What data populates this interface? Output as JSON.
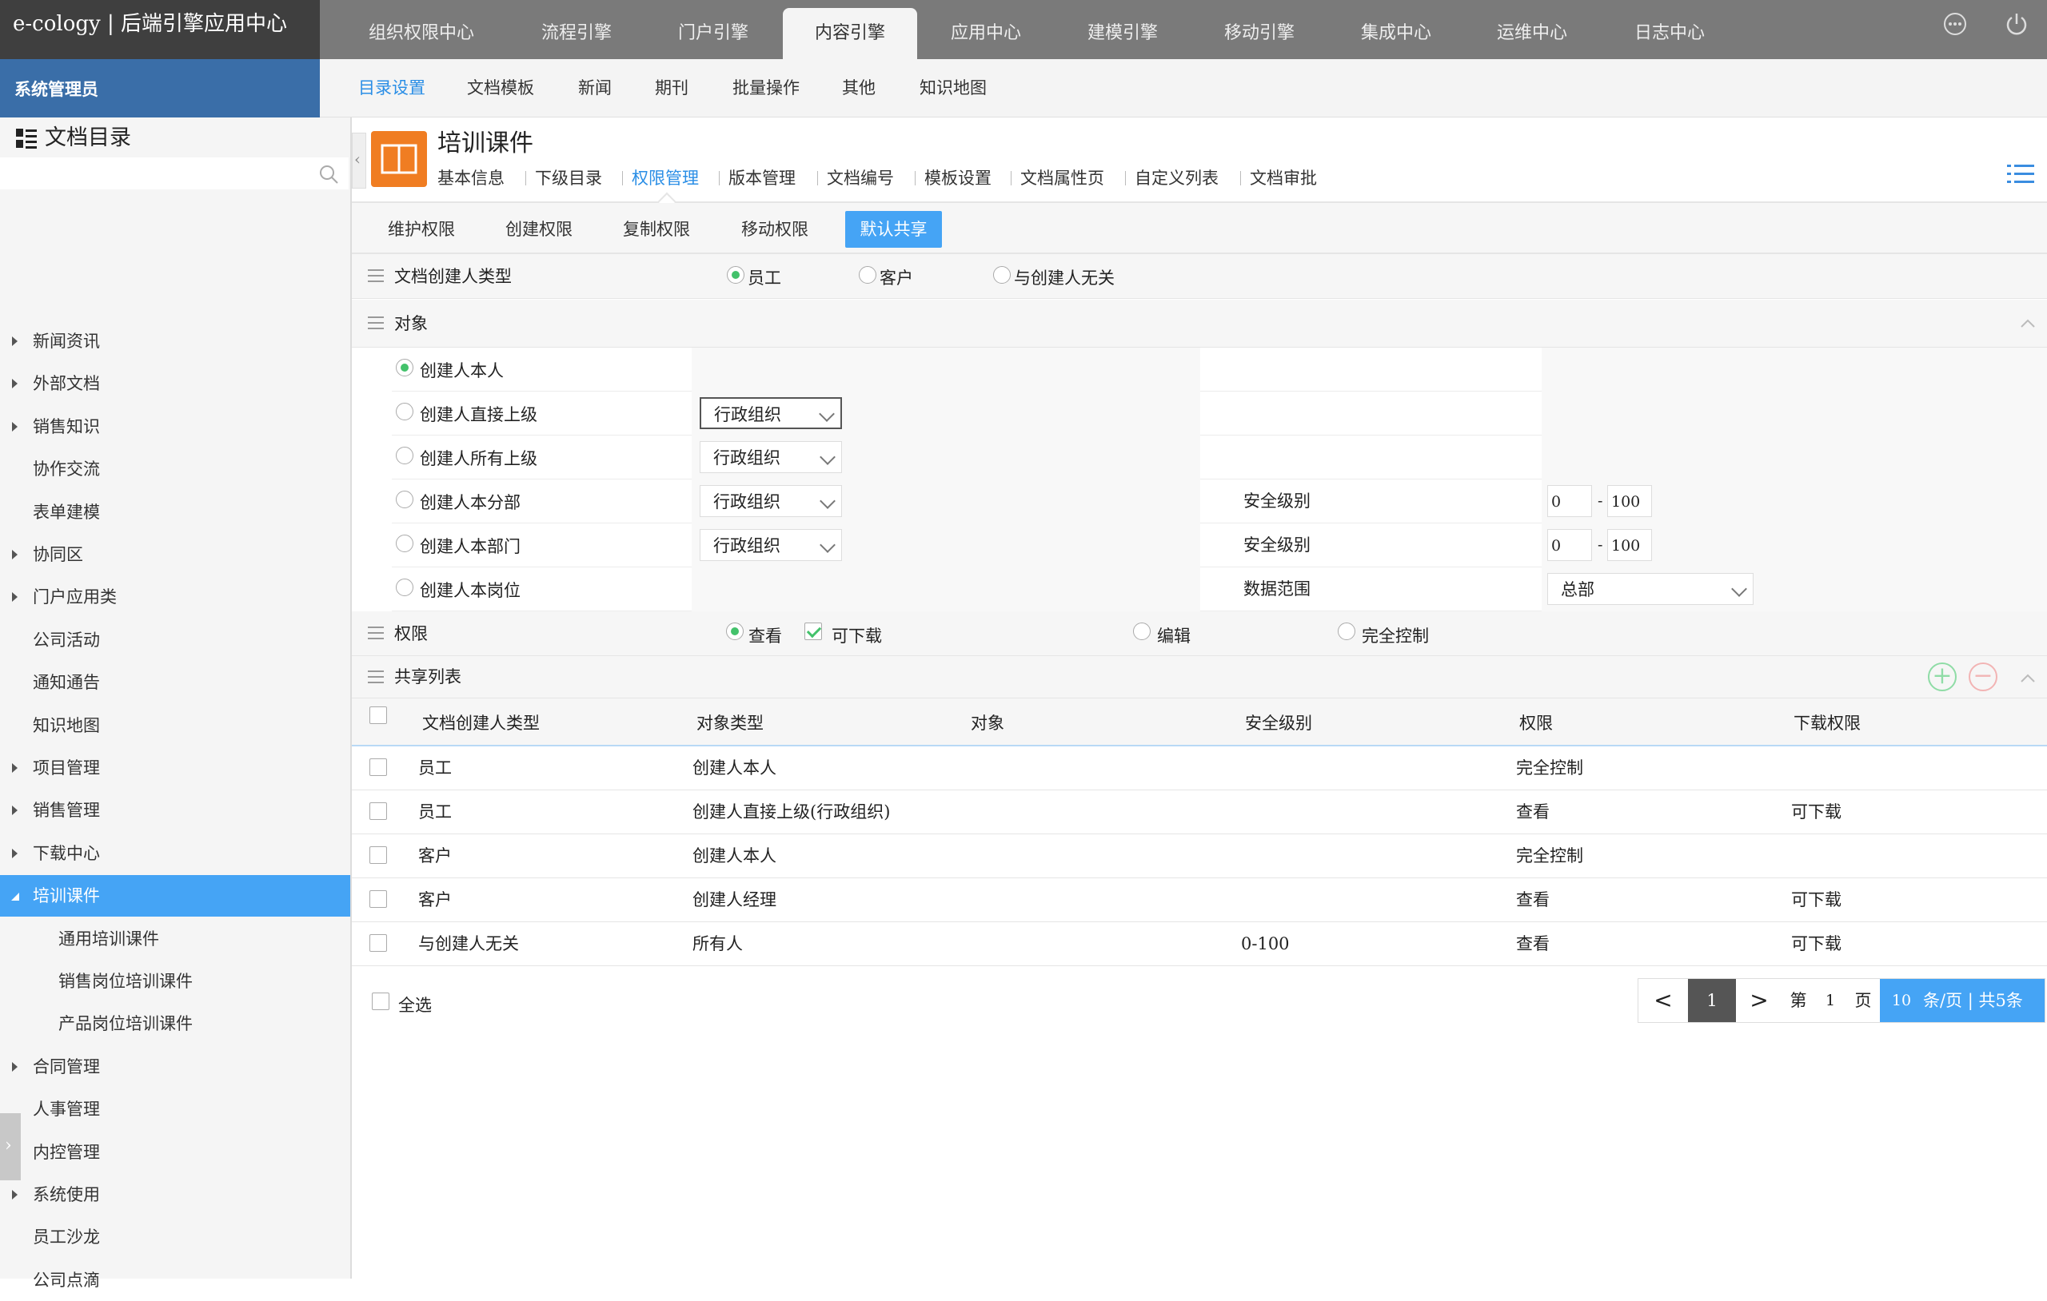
{
  "brand": {
    "title": "e-cology | 后端引擎应用中心"
  },
  "top_tabs": [
    {
      "label": "组织权限中心",
      "active": false
    },
    {
      "label": "流程引擎",
      "active": false
    },
    {
      "label": "门户引擎",
      "active": false
    },
    {
      "label": "内容引擎",
      "active": true
    },
    {
      "label": "应用中心",
      "active": false
    },
    {
      "label": "建模引擎",
      "active": false
    },
    {
      "label": "移动引擎",
      "active": false
    },
    {
      "label": "集成中心",
      "active": false
    },
    {
      "label": "运维中心",
      "active": false
    },
    {
      "label": "日志中心",
      "active": false
    }
  ],
  "top_icons": [
    "more-icon",
    "power-icon"
  ],
  "user": {
    "role": "系统管理员"
  },
  "sub_nav": [
    {
      "label": "目录设置",
      "active": true
    },
    {
      "label": "文档模板",
      "active": false
    },
    {
      "label": "新闻",
      "active": false
    },
    {
      "label": "期刊",
      "active": false
    },
    {
      "label": "批量操作",
      "active": false
    },
    {
      "label": "其他",
      "active": false
    },
    {
      "label": "知识地图",
      "active": false
    }
  ],
  "tree": {
    "title": "文档目录",
    "search_placeholder": "",
    "items": [
      {
        "label": "新闻资讯",
        "caret": true,
        "child": false,
        "active": false
      },
      {
        "label": "外部文档",
        "caret": true,
        "child": false,
        "active": false
      },
      {
        "label": "销售知识",
        "caret": true,
        "child": false,
        "active": false
      },
      {
        "label": "协作交流",
        "caret": false,
        "child": false,
        "active": false
      },
      {
        "label": "表单建模",
        "caret": false,
        "child": false,
        "active": false
      },
      {
        "label": "协同区",
        "caret": true,
        "child": false,
        "active": false
      },
      {
        "label": "门户应用类",
        "caret": true,
        "child": false,
        "active": false
      },
      {
        "label": "公司活动",
        "caret": false,
        "child": false,
        "active": false
      },
      {
        "label": "通知通告",
        "caret": false,
        "child": false,
        "active": false
      },
      {
        "label": "知识地图",
        "caret": false,
        "child": false,
        "active": false
      },
      {
        "label": "项目管理",
        "caret": true,
        "child": false,
        "active": false
      },
      {
        "label": "销售管理",
        "caret": true,
        "child": false,
        "active": false
      },
      {
        "label": "下载中心",
        "caret": true,
        "child": false,
        "active": false
      },
      {
        "label": "培训课件",
        "caret": true,
        "child": false,
        "active": true
      },
      {
        "label": "通用培训课件",
        "caret": false,
        "child": true,
        "active": false
      },
      {
        "label": "销售岗位培训课件",
        "caret": false,
        "child": true,
        "active": false
      },
      {
        "label": "产品岗位培训课件",
        "caret": false,
        "child": true,
        "active": false
      },
      {
        "label": "合同管理",
        "caret": true,
        "child": false,
        "active": false
      },
      {
        "label": "人事管理",
        "caret": false,
        "child": false,
        "active": false
      },
      {
        "label": "内控管理",
        "caret": true,
        "child": false,
        "active": false
      },
      {
        "label": "系统使用",
        "caret": true,
        "child": false,
        "active": false
      },
      {
        "label": "员工沙龙",
        "caret": false,
        "child": false,
        "active": false
      },
      {
        "label": "公司点滴",
        "caret": false,
        "child": false,
        "active": false
      }
    ]
  },
  "doc": {
    "title": "培训课件",
    "tabs": [
      {
        "label": "基本信息",
        "active": false
      },
      {
        "label": "下级目录",
        "active": false
      },
      {
        "label": "权限管理",
        "active": true
      },
      {
        "label": "版本管理",
        "active": false
      },
      {
        "label": "文档编号",
        "active": false
      },
      {
        "label": "模板设置",
        "active": false
      },
      {
        "label": "文档属性页",
        "active": false
      },
      {
        "label": "自定义列表",
        "active": false
      },
      {
        "label": "文档审批",
        "active": false
      }
    ]
  },
  "perm_tabs": [
    {
      "label": "维护权限",
      "active": false
    },
    {
      "label": "创建权限",
      "active": false
    },
    {
      "label": "复制权限",
      "active": false
    },
    {
      "label": "移动权限",
      "active": false
    },
    {
      "label": "默认共享",
      "active": true
    }
  ],
  "creator_type": {
    "label": "文档创建人类型",
    "options": [
      {
        "label": "员工",
        "checked": true
      },
      {
        "label": "客户",
        "checked": false
      },
      {
        "label": "与创建人无关",
        "checked": false
      }
    ]
  },
  "object_section": {
    "label": "对象"
  },
  "object_rows": [
    {
      "label": "创建人本人",
      "checked": true,
      "select": "",
      "field_label": "",
      "range_from": "",
      "range_to": "",
      "range_select": ""
    },
    {
      "label": "创建人直接上级",
      "checked": false,
      "select": "行政组织",
      "field_label": "",
      "range_from": "",
      "range_to": "",
      "range_select": ""
    },
    {
      "label": "创建人所有上级",
      "checked": false,
      "select": "行政组织",
      "field_label": "",
      "range_from": "",
      "range_to": "",
      "range_select": ""
    },
    {
      "label": "创建人本分部",
      "checked": false,
      "select": "行政组织",
      "field_label": "安全级别",
      "range_from": "0",
      "range_to": "100",
      "range_select": ""
    },
    {
      "label": "创建人本部门",
      "checked": false,
      "select": "行政组织",
      "field_label": "安全级别",
      "range_from": "0",
      "range_to": "100",
      "range_select": ""
    },
    {
      "label": "创建人本岗位",
      "checked": false,
      "select": "",
      "field_label": "数据范围",
      "range_from": "",
      "range_to": "",
      "range_select": "总部"
    }
  ],
  "permission": {
    "label": "权限",
    "options": [
      {
        "label": "查看",
        "kind": "radio",
        "checked": true
      },
      {
        "label": "可下载",
        "kind": "checkbox",
        "checked": true
      },
      {
        "label": "编辑",
        "kind": "radio",
        "checked": false
      },
      {
        "label": "完全控制",
        "kind": "radio",
        "checked": false
      }
    ]
  },
  "share_list": {
    "label": "共享列表",
    "columns": [
      "文档创建人类型",
      "对象类型",
      "对象",
      "安全级别",
      "权限",
      "下载权限"
    ],
    "rows": [
      [
        "员工",
        "创建人本人",
        "",
        "",
        "完全控制",
        ""
      ],
      [
        "员工",
        "创建人直接上级(行政组织)",
        "",
        "",
        "查看",
        "可下载"
      ],
      [
        "客户",
        "创建人本人",
        "",
        "",
        "完全控制",
        ""
      ],
      [
        "客户",
        "创建人经理",
        "",
        "",
        "查看",
        "可下载"
      ],
      [
        "与创建人无关",
        "所有人",
        "",
        "0-100",
        "查看",
        "可下载"
      ]
    ],
    "select_all": "全选"
  },
  "pager": {
    "prev": "<",
    "current": "1",
    "next": ">",
    "page_prefix": "第",
    "page_num": "1",
    "page_suffix": "页",
    "page_size": "10",
    "summary": "条/页 | 共5条"
  },
  "colors": {
    "accent": "#45a4f5",
    "header": "#7a7a7a",
    "user_bar": "#3a6ea8",
    "doc_icon": "#f07d22",
    "check": "#43c26b"
  }
}
